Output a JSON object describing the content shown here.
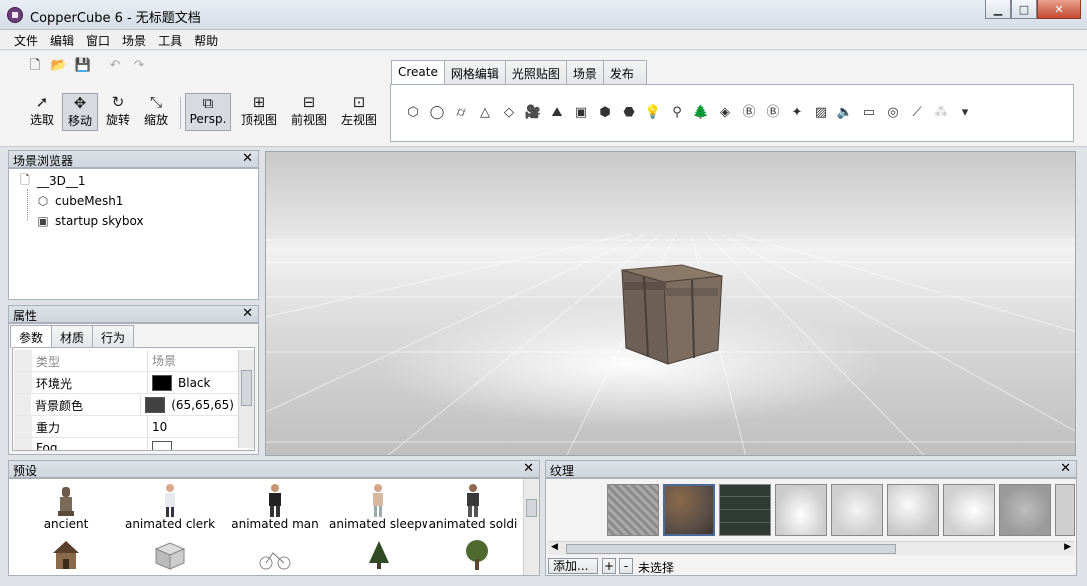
{
  "window": {
    "title": "CopperCube 6 - 无标题文档"
  },
  "menu": [
    "文件",
    "编辑",
    "窗口",
    "场景",
    "工具",
    "帮助"
  ],
  "tools": [
    {
      "label": "选取",
      "icon": "pointer-icon"
    },
    {
      "label": "移动",
      "icon": "move-icon"
    },
    {
      "label": "旋转",
      "icon": "rotate-icon"
    },
    {
      "label": "缩放",
      "icon": "scale-icon"
    },
    {
      "label": "Persp.",
      "icon": "perspective-icon"
    },
    {
      "label": "顶视图",
      "icon": "top-view-icon"
    },
    {
      "label": "前视图",
      "icon": "front-view-icon"
    },
    {
      "label": "左视图",
      "icon": "left-view-icon"
    }
  ],
  "create_tabs": [
    "Create",
    "网格编辑",
    "光照贴图",
    "场景",
    "发布"
  ],
  "scene_browser": {
    "title": "场景浏览器",
    "items": [
      "__3D__1",
      "cubeMesh1",
      "startup skybox"
    ]
  },
  "properties": {
    "title": "属性",
    "tabs": [
      "参数",
      "材质",
      "行为"
    ],
    "header": {
      "key": "类型",
      "value": "场景"
    },
    "rows": [
      {
        "key": "环境光",
        "value": "Black",
        "color": "#000000"
      },
      {
        "key": "背景颜色",
        "value": "(65,65,65)",
        "color": "#414141"
      },
      {
        "key": "重力",
        "value": "10"
      },
      {
        "key": "Fog",
        "value": ""
      }
    ]
  },
  "presets": {
    "title": "预设",
    "items": [
      "ancient",
      "animated clerk",
      "animated man",
      "animated sleepwalk",
      "animated soldi"
    ]
  },
  "textures": {
    "title": "纹理",
    "add_label": "添加...",
    "plus": "+",
    "minus": "-",
    "status": "未选择"
  }
}
